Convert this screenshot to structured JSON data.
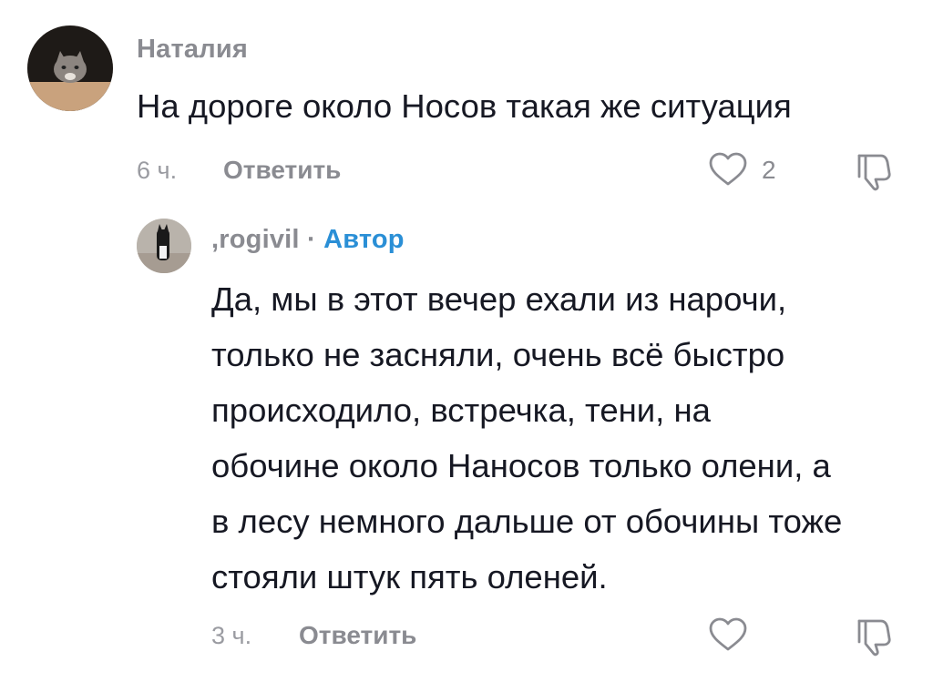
{
  "comments": [
    {
      "username": "Наталия",
      "text": "На дороге около Носов такая же ситуация",
      "time": "6 ч.",
      "reply_label": "Ответить",
      "likes": "2",
      "avatar_icon": "cat-avatar",
      "like_icon": "heart-icon",
      "dislike_icon": "thumbs-down-icon"
    },
    {
      "username": ",rogivil",
      "separator": "·",
      "author_badge": "Автор",
      "text": "Да, мы в этот вечер ехали из нарочи,\nтолько не засняли, очень всё быстро\nпроисходило, встречка, тени, на\nобочине около Наносов только олени, а\nв лесу немного дальше от обочины тоже\nстояли штук пять оленей.",
      "time": "3 ч.",
      "reply_label": "Ответить",
      "likes": "",
      "avatar_icon": "cat-avatar",
      "like_icon": "heart-icon",
      "dislike_icon": "thumbs-down-icon"
    }
  ],
  "colors": {
    "text": "#161823",
    "muted": "#8a8b91",
    "author_badge": "#2a8fd6",
    "background": "#ffffff"
  }
}
